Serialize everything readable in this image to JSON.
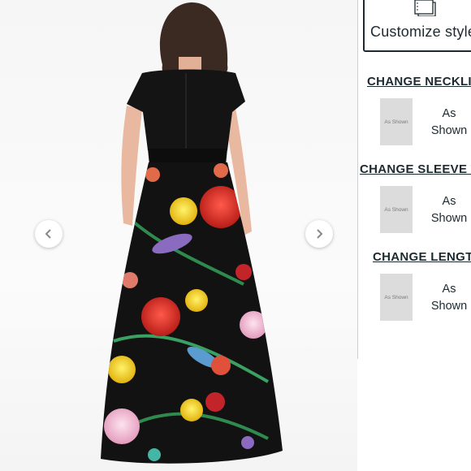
{
  "gallery": {
    "prev_icon": "chevron-left-icon",
    "next_icon": "chevron-right-icon"
  },
  "panel": {
    "customize_label": "Customize style",
    "customize_icon": "document-stack-icon",
    "sections": [
      {
        "title": "CHANGE NECKLINE",
        "thumb_text": "As Shown",
        "option_line1": "As",
        "option_line2": "Shown"
      },
      {
        "title": "CHANGE SLEEVE TYPE",
        "thumb_text": "As Shown",
        "option_line1": "As",
        "option_line2": "Shown"
      },
      {
        "title": "CHANGE LENGTH",
        "thumb_text": "As Shown",
        "option_line1": "As",
        "option_line2": "Shown"
      }
    ]
  },
  "colors": {
    "text_dark": "#1d2a30",
    "thumb_bg": "#dcdcdc",
    "dress_black": "#111111"
  }
}
